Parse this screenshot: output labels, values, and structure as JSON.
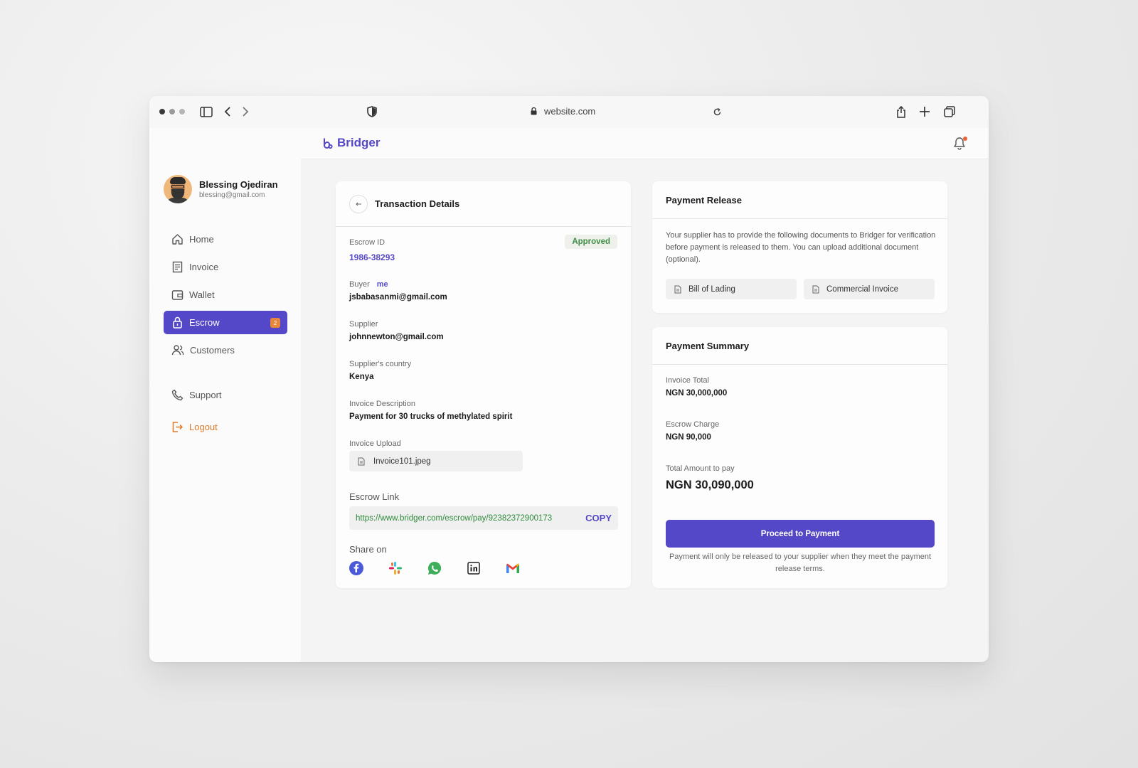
{
  "browser": {
    "url": "website.com"
  },
  "brand": {
    "name": "Bridger"
  },
  "user": {
    "name": "Blessing Ojediran",
    "email": "blessing@gmail.com"
  },
  "nav": {
    "home": "Home",
    "invoice": "Invoice",
    "wallet": "Wallet",
    "escrow": "Escrow",
    "escrow_badge": "2",
    "customers": "Customers",
    "support": "Support",
    "logout": "Logout"
  },
  "transaction": {
    "title": "Transaction Details",
    "status": "Approved",
    "escrow_id_label": "Escrow ID",
    "escrow_id": "1986-38293",
    "buyer_label": "Buyer",
    "buyer_tag": "me",
    "buyer_email": "jsbabasanmi@gmail.com",
    "supplier_label": "Supplier",
    "supplier_email": "johnnewton@gmail.com",
    "country_label": "Supplier's country",
    "country": "Kenya",
    "desc_label": "Invoice Description",
    "desc": "Payment for 30 trucks of methylated spirit",
    "upload_label": "Invoice Upload",
    "upload_file": "Invoice101.jpeg",
    "link_label": "Escrow Link",
    "link": "https://www.bridger.com/escrow/pay/92382372900173",
    "copy_label": "COPY",
    "share_label": "Share on",
    "share_icons": [
      "facebook-icon",
      "slack-icon",
      "whatsapp-icon",
      "linkedin-icon",
      "gmail-icon"
    ]
  },
  "release": {
    "title": "Payment Release",
    "text": "Your supplier has to provide the following documents to Bridger for verification before payment is released to them. You can upload additional document (optional).",
    "docs": [
      "Bill of Lading",
      "Commercial Invoice"
    ]
  },
  "summary": {
    "title": "Payment Summary",
    "invoice_total_label": "Invoice Total",
    "invoice_total": "NGN 30,000,000",
    "charge_label": "Escrow Charge",
    "charge": "NGN 90,000",
    "total_label": "Total Amount to pay",
    "total": "NGN 30,090,000",
    "button": "Proceed to Payment",
    "note": "Payment will only be released to your supplier when they meet the payment release terms."
  },
  "colors": {
    "accent": "#5548c8",
    "approved": "#3f8f45",
    "logout": "#e07a2b",
    "badge": "#e8863b"
  }
}
